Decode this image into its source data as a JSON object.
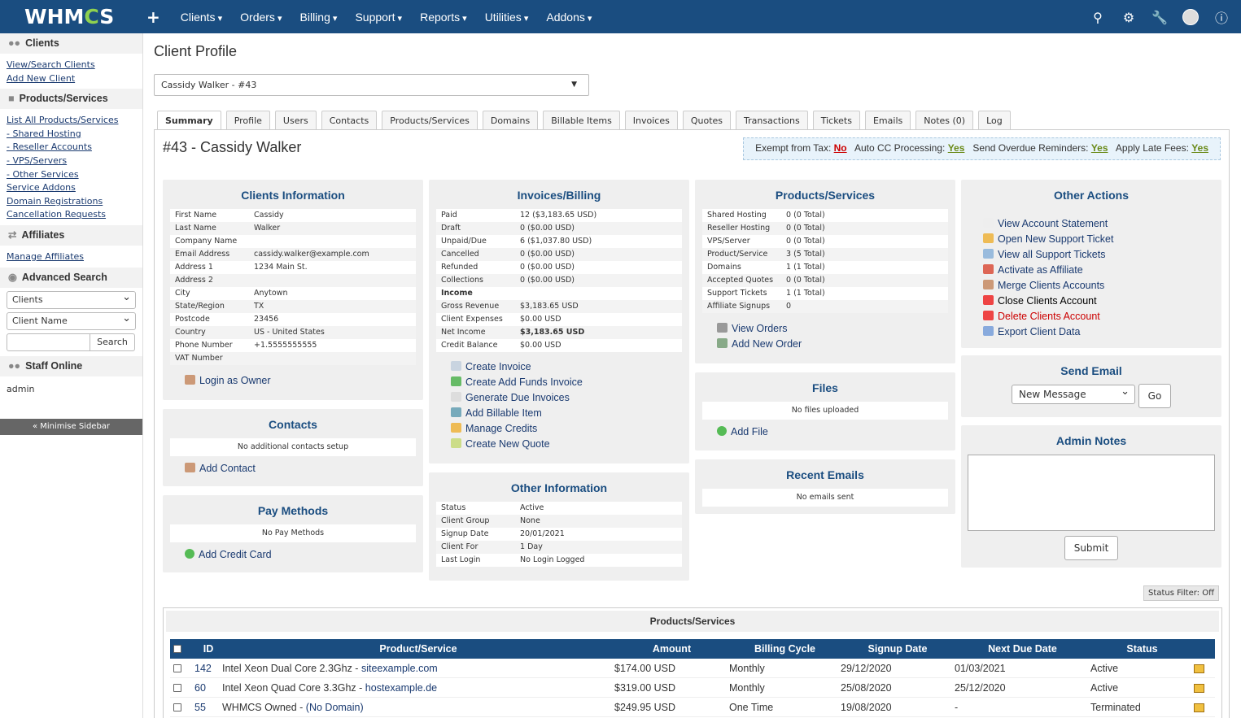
{
  "topbar": {
    "logo": "WHMCS",
    "plus": "+",
    "nav": [
      "Clients",
      "Orders",
      "Billing",
      "Support",
      "Reports",
      "Utilities",
      "Addons"
    ]
  },
  "sidebar": {
    "clients": {
      "title": "Clients",
      "links": [
        "View/Search Clients",
        "Add New Client"
      ]
    },
    "products": {
      "title": "Products/Services",
      "links": [
        "List All Products/Services",
        "- Shared Hosting",
        "- Reseller Accounts",
        "- VPS/Servers",
        "- Other Services",
        "Service Addons",
        "Domain Registrations",
        "Cancellation Requests"
      ]
    },
    "affiliates": {
      "title": "Affiliates",
      "links": [
        "Manage Affiliates"
      ]
    },
    "advanced": {
      "title": "Advanced Search",
      "select1": "Clients",
      "select2": "Client Name",
      "search_btn": "Search"
    },
    "staff": {
      "title": "Staff Online",
      "user": "admin"
    },
    "minimise": "« Minimise Sidebar"
  },
  "page": {
    "title": "Client Profile",
    "client_select": "Cassidy Walker - #43"
  },
  "tabs": [
    "Summary",
    "Profile",
    "Users",
    "Contacts",
    "Products/Services",
    "Domains",
    "Billable Items",
    "Invoices",
    "Quotes",
    "Transactions",
    "Tickets",
    "Emails",
    "Notes (0)",
    "Log"
  ],
  "client_title": "#43 - Cassidy Walker",
  "flags": {
    "tax_label": "Exempt from Tax:",
    "tax": "No",
    "cc_label": "Auto CC Processing:",
    "cc": "Yes",
    "od_label": "Send Overdue Reminders:",
    "od": "Yes",
    "late_label": "Apply Late Fees:",
    "late": "Yes"
  },
  "client_info": {
    "title": "Clients Information",
    "rows": [
      [
        "First Name",
        "Cassidy"
      ],
      [
        "Last Name",
        "Walker"
      ],
      [
        "Company Name",
        ""
      ],
      [
        "Email Address",
        "cassidy.walker@example.com"
      ],
      [
        "Address 1",
        "1234 Main St."
      ],
      [
        "Address 2",
        ""
      ],
      [
        "City",
        "Anytown"
      ],
      [
        "State/Region",
        "TX"
      ],
      [
        "Postcode",
        "23456"
      ],
      [
        "Country",
        "US - United States"
      ],
      [
        "Phone Number",
        "+1.5555555555"
      ],
      [
        "VAT Number",
        ""
      ]
    ],
    "action": "Login as Owner"
  },
  "contacts": {
    "title": "Contacts",
    "msg": "No additional contacts setup",
    "action": "Add Contact"
  },
  "pay_methods": {
    "title": "Pay Methods",
    "msg": "No Pay Methods",
    "action": "Add Credit Card"
  },
  "invoices": {
    "title": "Invoices/Billing",
    "rows": [
      [
        "Paid",
        "12 ($3,183.65 USD)"
      ],
      [
        "Draft",
        "0 ($0.00 USD)"
      ],
      [
        "Unpaid/Due",
        "6 ($1,037.80 USD)"
      ],
      [
        "Cancelled",
        "0 ($0.00 USD)"
      ],
      [
        "Refunded",
        "0 ($0.00 USD)"
      ],
      [
        "Collections",
        "0 ($0.00 USD)"
      ],
      [
        "Income",
        ""
      ],
      [
        "Gross Revenue",
        "$3,183.65 USD"
      ],
      [
        "Client Expenses",
        "$0.00 USD"
      ],
      [
        "Net Income",
        "$3,183.65 USD"
      ],
      [
        "Credit Balance",
        "$0.00 USD"
      ]
    ],
    "actions": [
      "Create Invoice",
      "Create Add Funds Invoice",
      "Generate Due Invoices",
      "Add Billable Item",
      "Manage Credits",
      "Create New Quote"
    ]
  },
  "other_info": {
    "title": "Other Information",
    "rows": [
      [
        "Status",
        "Active"
      ],
      [
        "Client Group",
        "None"
      ],
      [
        "Signup Date",
        "20/01/2021"
      ],
      [
        "Client For",
        "1 Day"
      ],
      [
        "Last Login",
        "No Login Logged"
      ]
    ]
  },
  "products": {
    "title": "Products/Services",
    "rows": [
      [
        "Shared Hosting",
        "0 (0 Total)"
      ],
      [
        "Reseller Hosting",
        "0 (0 Total)"
      ],
      [
        "VPS/Server",
        "0 (0 Total)"
      ],
      [
        "Product/Service",
        "3 (5 Total)"
      ],
      [
        "Domains",
        "1 (1 Total)"
      ],
      [
        "Accepted Quotes",
        "0 (0 Total)"
      ],
      [
        "Support Tickets",
        "1 (1 Total)"
      ],
      [
        "Affiliate Signups",
        "0"
      ]
    ],
    "actions": [
      "View Orders",
      "Add New Order"
    ]
  },
  "files": {
    "title": "Files",
    "msg": "No files uploaded",
    "action": "Add File"
  },
  "recent_emails": {
    "title": "Recent Emails",
    "msg": "No emails sent"
  },
  "other_actions": {
    "title": "Other Actions",
    "actions": [
      "View Account Statement",
      "Open New Support Ticket",
      "View all Support Tickets",
      "Activate as Affiliate",
      "Merge Clients Accounts",
      "Close Clients Account",
      "Delete Clients Account",
      "Export Client Data"
    ]
  },
  "send_email": {
    "title": "Send Email",
    "select": "New Message",
    "go": "Go"
  },
  "admin_notes": {
    "title": "Admin Notes",
    "submit": "Submit"
  },
  "status_filter": "Status Filter: Off",
  "ps_table": {
    "title": "Products/Services",
    "headers": [
      "ID",
      "Product/Service",
      "Amount",
      "Billing Cycle",
      "Signup Date",
      "Next Due Date",
      "Status"
    ],
    "rows": [
      {
        "id": "142",
        "product": "Intel Xeon Dual Core 2.3Ghz - ",
        "domain": "siteexample.com",
        "amount": "$174.00 USD",
        "cycle": "Monthly",
        "signup": "29/12/2020",
        "due": "01/03/2021",
        "status": "Active"
      },
      {
        "id": "60",
        "product": "Intel Xeon Quad Core 3.3Ghz - ",
        "domain": "hostexample.de",
        "amount": "$319.00 USD",
        "cycle": "Monthly",
        "signup": "25/08/2020",
        "due": "25/12/2020",
        "status": "Active"
      },
      {
        "id": "55",
        "product": "WHMCS Owned - ",
        "domain": "(No Domain)",
        "amount": "$249.95 USD",
        "cycle": "One Time",
        "signup": "19/08/2020",
        "due": "-",
        "status": "Terminated"
      }
    ]
  }
}
